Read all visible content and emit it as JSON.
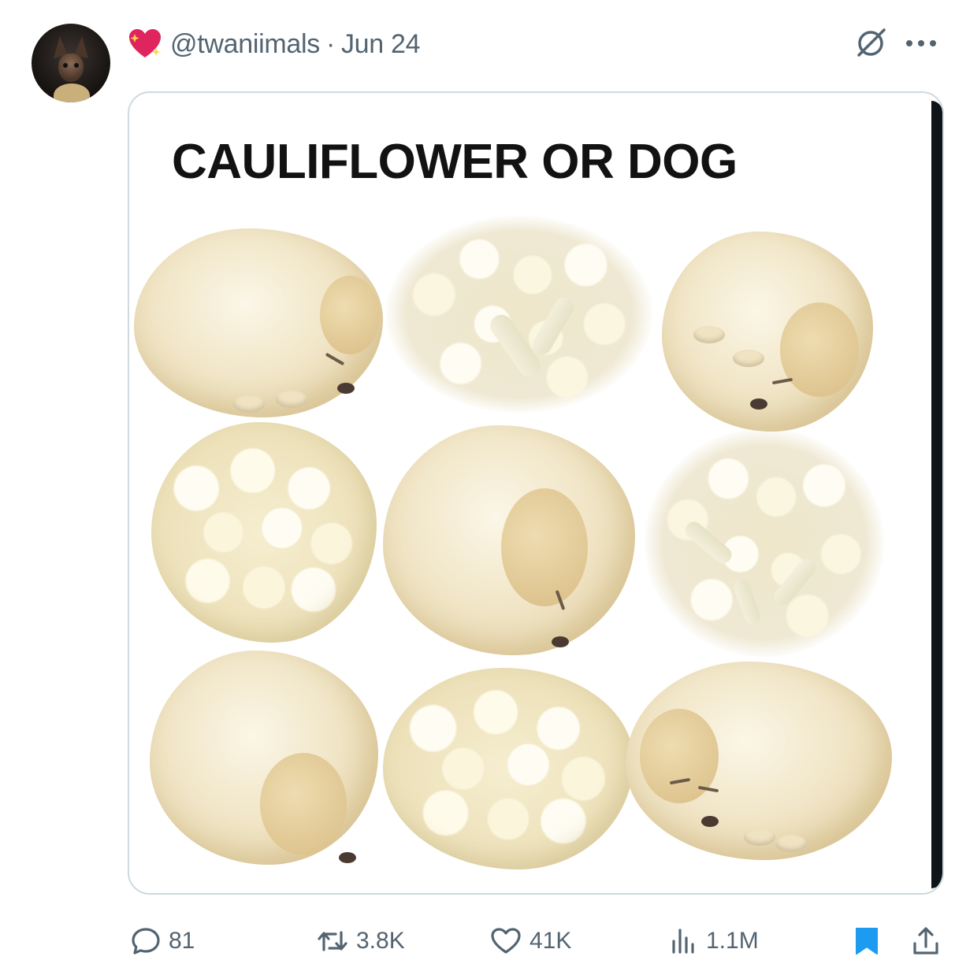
{
  "tweet": {
    "handle": "@twaniimals",
    "separator": "·",
    "date": "Jun 24",
    "media_title": "CAULIFLOWER OR DOG"
  },
  "actions": {
    "replies": "81",
    "reposts": "3.8K",
    "likes": "41K",
    "views": "1.1M"
  },
  "grid": [
    [
      "dog",
      "cauliflower",
      "dog"
    ],
    [
      "cauliflower",
      "dog",
      "cauliflower"
    ],
    [
      "dog",
      "cauliflower",
      "dog"
    ]
  ],
  "icons": {
    "grok": "grok-icon",
    "more": "more-icon",
    "reply": "reply-icon",
    "repost": "repost-icon",
    "like": "like-icon",
    "views": "views-icon",
    "bookmark": "bookmark-icon",
    "share": "share-icon",
    "badge": "sparkling-heart-icon"
  },
  "colors": {
    "secondary_text": "#536471",
    "bookmark_active": "#1d9bf0",
    "heart_badge": "#e0245e"
  }
}
